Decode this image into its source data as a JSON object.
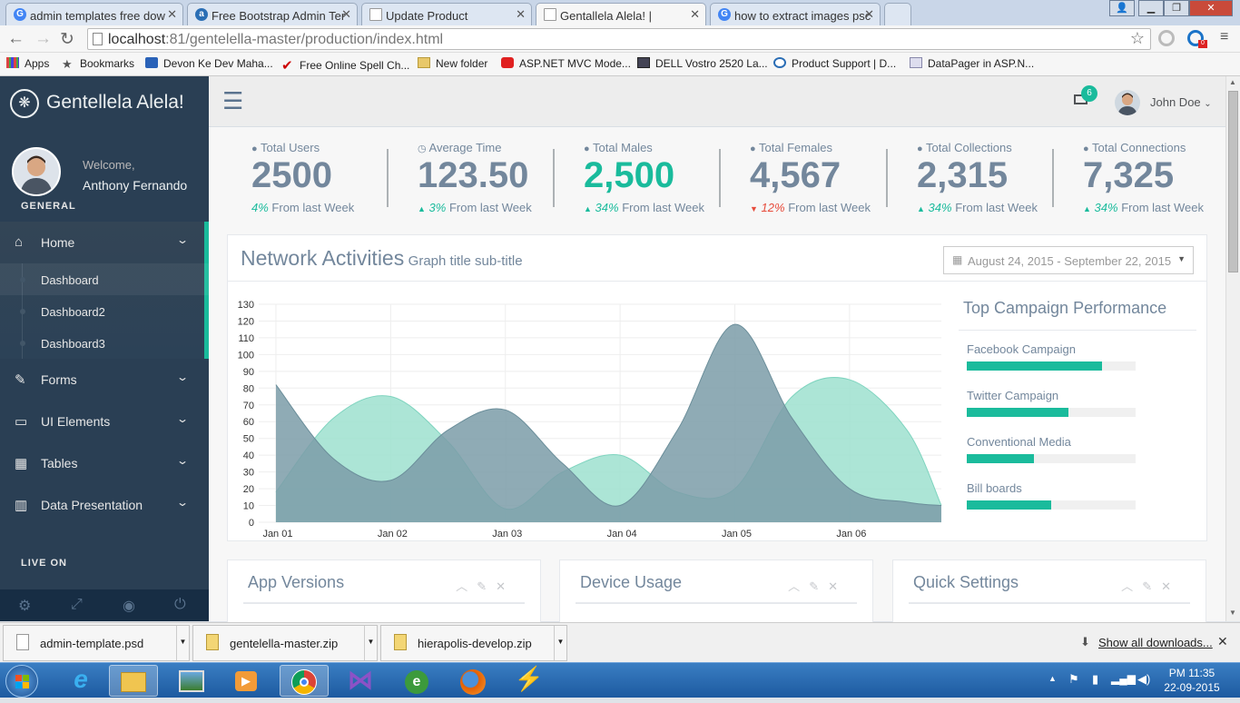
{
  "browser": {
    "tabs": [
      {
        "title": "admin templates free dow",
        "icon": "G",
        "color": "#4285f4"
      },
      {
        "title": "Free Bootstrap Admin Ter",
        "icon": "a",
        "color": "#2b6fb5"
      },
      {
        "title": "Update Product",
        "icon": "",
        "color": "#888"
      },
      {
        "title": "Gentallela Alela! |",
        "icon": "",
        "color": "#888"
      },
      {
        "title": "how to extract images psc",
        "icon": "G",
        "color": "#4285f4"
      }
    ],
    "url_host": "localhost",
    "url_path": ":81/gentelella-master/production/index.html",
    "bookmarks": [
      {
        "label": "Apps",
        "color": "#d44"
      },
      {
        "label": "Bookmarks",
        "color": "#555"
      },
      {
        "label": "Devon Ke Dev Maha...",
        "color": "#2a62b8"
      },
      {
        "label": "Free Online Spell Ch...",
        "color": "#c00"
      },
      {
        "label": "New folder",
        "color": "#e8c86a"
      },
      {
        "label": "ASP.NET MVC Mode...",
        "color": "#e02020"
      },
      {
        "label": "DELL Vostro 2520 La...",
        "color": "#445"
      },
      {
        "label": "Product Support | D...",
        "color": "#2a6db5"
      },
      {
        "label": "DataPager in ASP.N...",
        "color": "#88a"
      }
    ]
  },
  "sidebar": {
    "brand": "Gentellela Alela!",
    "welcome": "Welcome,",
    "user_name": "Anthony Fernando",
    "section_general": "GENERAL",
    "section_live": "LIVE ON",
    "menu": [
      {
        "label": "Home",
        "icon": "home-icon"
      },
      {
        "label": "Forms",
        "icon": "edit-icon"
      },
      {
        "label": "UI Elements",
        "icon": "desktop-icon"
      },
      {
        "label": "Tables",
        "icon": "table-icon"
      },
      {
        "label": "Data Presentation",
        "icon": "bar-chart-icon"
      }
    ],
    "submenu": [
      {
        "label": "Dashboard"
      },
      {
        "label": "Dashboard2"
      },
      {
        "label": "Dashboard3"
      }
    ]
  },
  "topnav": {
    "mail_count": "6",
    "user": "John Doe"
  },
  "stats": [
    {
      "title": "Total Users",
      "value": "2500",
      "pct": "4%",
      "suffix": "From last Week",
      "trend": "none",
      "accent": false
    },
    {
      "title": "Average Time",
      "value": "123.50",
      "pct": "3%",
      "suffix": "From last Week",
      "trend": "up",
      "accent": false
    },
    {
      "title": "Total Males",
      "value": "2,500",
      "pct": "34%",
      "suffix": "From last Week",
      "trend": "up",
      "accent": true
    },
    {
      "title": "Total Females",
      "value": "4,567",
      "pct": "12%",
      "suffix": "From last Week",
      "trend": "down",
      "accent": false
    },
    {
      "title": "Total Collections",
      "value": "2,315",
      "pct": "34%",
      "suffix": "From last Week",
      "trend": "up",
      "accent": false
    },
    {
      "title": "Total Connections",
      "value": "7,325",
      "pct": "34%",
      "suffix": "From last Week",
      "trend": "up",
      "accent": false
    }
  ],
  "network": {
    "title": "Network Activities",
    "subtitle": "Graph title sub-title",
    "daterange": "August 24, 2015 - September 22, 2015"
  },
  "chart_data": {
    "type": "area",
    "x": [
      0,
      0.5,
      1,
      1.5,
      2,
      2.5,
      3,
      3.5,
      4,
      4.5,
      5,
      5.5,
      6
    ],
    "xticks": [
      "Jan 01",
      "Jan 02",
      "Jan 03",
      "Jan 04",
      "Jan 05",
      "Jan 06"
    ],
    "yticks": [
      0,
      10,
      20,
      30,
      40,
      50,
      60,
      70,
      80,
      90,
      100,
      110,
      120,
      130
    ],
    "ylim": [
      0,
      130
    ],
    "xlim": [
      -0.15,
      5.8
    ],
    "series": [
      {
        "color": "#9ee0cf",
        "values": [
          18,
          62,
          75,
          48,
          8,
          30,
          40,
          18,
          20,
          75,
          85,
          55,
          10
        ]
      },
      {
        "color": "#7b9ca8",
        "values": [
          82,
          38,
          25,
          55,
          67,
          35,
          10,
          55,
          118,
          62,
          20,
          12,
          10
        ]
      }
    ]
  },
  "campaign": {
    "title": "Top Campaign Performance",
    "items": [
      {
        "label": "Facebook Campaign",
        "value": 0.8
      },
      {
        "label": "Twitter Campaign",
        "value": 0.6
      },
      {
        "label": "Conventional Media",
        "value": 0.4
      },
      {
        "label": "Bill boards",
        "value": 0.5
      }
    ]
  },
  "panels": [
    {
      "title": "App Versions"
    },
    {
      "title": "Device Usage"
    },
    {
      "title": "Quick Settings"
    }
  ],
  "downloads": {
    "items": [
      {
        "name": "admin-template.psd"
      },
      {
        "name": "gentelella-master.zip"
      },
      {
        "name": "hierapolis-develop.zip"
      }
    ],
    "show_all": "Show all downloads..."
  },
  "taskbar": {
    "time": "PM 11:35",
    "date": "22-09-2015"
  }
}
